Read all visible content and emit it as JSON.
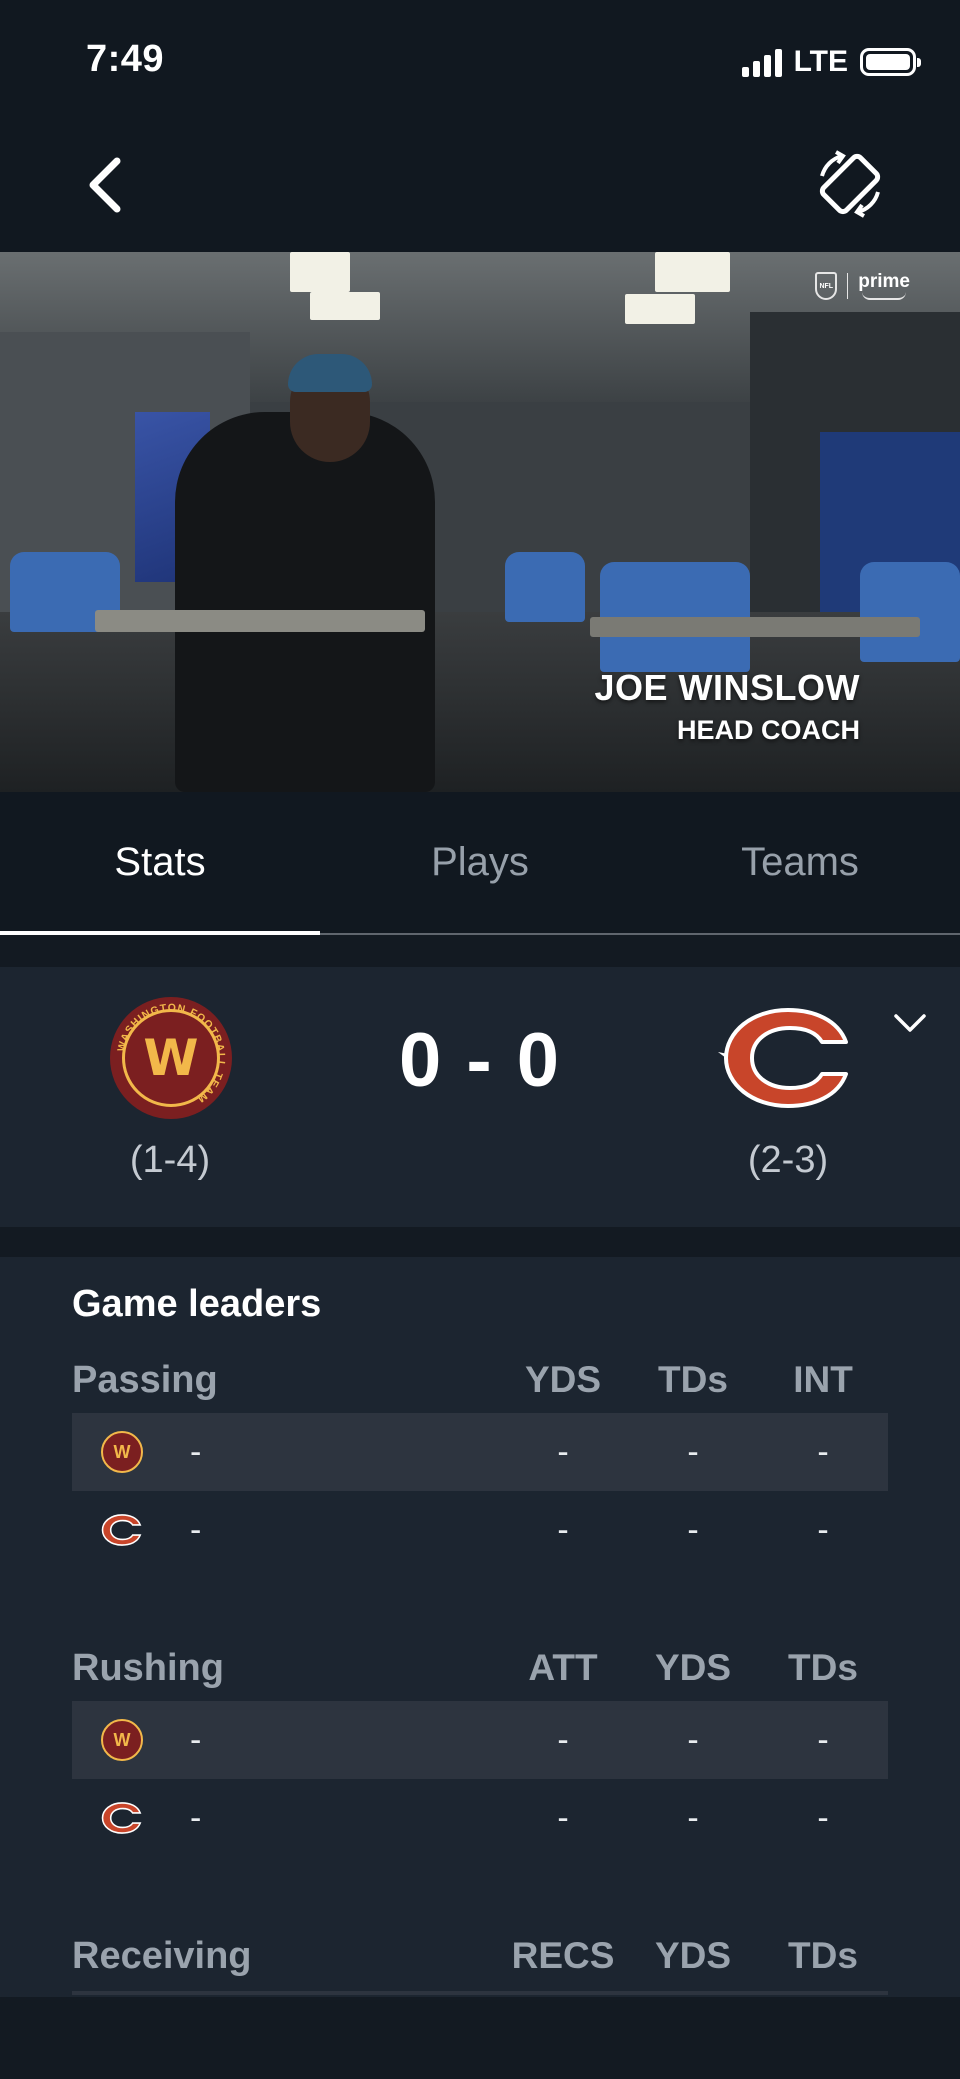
{
  "status_bar": {
    "time": "7:49",
    "network": "LTE"
  },
  "video": {
    "name": "JOE WINSLOW",
    "title": "HEAD COACH",
    "watermark": {
      "league": "NFL",
      "service": "prime"
    }
  },
  "tabs": [
    {
      "label": "Stats",
      "active": true
    },
    {
      "label": "Plays",
      "active": false
    },
    {
      "label": "Teams",
      "active": false
    }
  ],
  "scoreboard": {
    "score": "0 - 0",
    "away": {
      "logo": "washington-football-team-logo",
      "logo_text": "WASHINGTON FOOTBALL TEAM",
      "record": "(1-4)"
    },
    "home": {
      "logo": "chicago-bears-logo",
      "record": "(2-3)"
    }
  },
  "game_leaders": {
    "title": "Game leaders",
    "passing": {
      "label": "Passing",
      "columns": [
        "YDS",
        "TDs",
        "INT"
      ],
      "rows": [
        {
          "team": "washington",
          "player": "-",
          "values": [
            "-",
            "-",
            "-"
          ]
        },
        {
          "team": "chicago",
          "player": "-",
          "values": [
            "-",
            "-",
            "-"
          ]
        }
      ]
    },
    "rushing": {
      "label": "Rushing",
      "columns": [
        "ATT",
        "YDS",
        "TDs"
      ],
      "rows": [
        {
          "team": "washington",
          "player": "-",
          "values": [
            "-",
            "-",
            "-"
          ]
        },
        {
          "team": "chicago",
          "player": "-",
          "values": [
            "-",
            "-",
            "-"
          ]
        }
      ]
    },
    "receiving": {
      "label": "Receiving",
      "columns": [
        "RECS",
        "YDS",
        "TDs"
      ]
    }
  },
  "colors": {
    "background": "#131a22",
    "panel": "#1c2530",
    "row_shade": "#2d343f",
    "washington_burgundy": "#7b1f20",
    "washington_gold": "#f2b84a",
    "bears_orange": "#c8452a"
  },
  "icons": {
    "back": "chevron-left-icon",
    "rotate": "rotate-screen-icon",
    "expand": "chevron-down-icon"
  }
}
